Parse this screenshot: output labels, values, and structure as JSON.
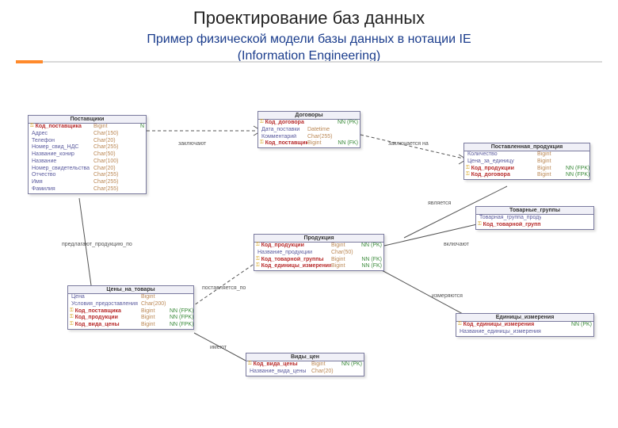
{
  "title": "Проектирование баз данных",
  "subtitle_line1": "Пример физической модели базы данных в нотации IE",
  "subtitle_line2": "(Information Engineering)",
  "entities": {
    "suppliers": {
      "name": "Поставщики",
      "fields": [
        {
          "k": "pk",
          "n": "Код_поставщика",
          "t": "Bigint",
          "f": "N"
        },
        {
          "k": "",
          "n": "Адрес",
          "t": "Char(150)",
          "f": ""
        },
        {
          "k": "",
          "n": "Телефон",
          "t": "Char(20)",
          "f": ""
        },
        {
          "k": "",
          "n": "Номер_свид_НДС",
          "t": "Char(255)",
          "f": ""
        },
        {
          "k": "",
          "n": "Название_конир",
          "t": "Char(50)",
          "f": ""
        },
        {
          "k": "",
          "n": "Название",
          "t": "Char(100)",
          "f": ""
        },
        {
          "k": "",
          "n": "Номер_свидетельства",
          "t": "Char(20)",
          "f": ""
        },
        {
          "k": "",
          "n": "Отчество",
          "t": "Char(255)",
          "f": ""
        },
        {
          "k": "",
          "n": "Имя",
          "t": "Char(255)",
          "f": ""
        },
        {
          "k": "",
          "n": "Фамилия",
          "t": "Char(255)",
          "f": ""
        }
      ]
    },
    "contracts": {
      "name": "Договоры",
      "fields": [
        {
          "k": "pk",
          "n": "Код_договора",
          "t": "",
          "f": "NN (PK)"
        },
        {
          "k": "",
          "n": "Дата_поставки",
          "t": "Datetime",
          "f": ""
        },
        {
          "k": "",
          "n": "Комментарий",
          "t": "Char(255)",
          "f": ""
        },
        {
          "k": "pk",
          "n": "Код_поставщика",
          "t": "Bigint",
          "f": "NN (FK)"
        }
      ]
    },
    "deliveries": {
      "name": "Поставленная_продукция",
      "fields": [
        {
          "k": "",
          "n": "Количество",
          "t": "Bigint",
          "f": ""
        },
        {
          "k": "",
          "n": "Цена_за_единицу",
          "t": "Bigint",
          "f": ""
        },
        {
          "k": "pk",
          "n": "Код_продукции",
          "t": "Bigint",
          "f": "NN (FPK)"
        },
        {
          "k": "pk",
          "n": "Код_договора",
          "t": "Bigint",
          "f": "NN (FPK)"
        }
      ]
    },
    "products": {
      "name": "Продукция",
      "fields": [
        {
          "k": "pk",
          "n": "Код_продукции",
          "t": "Bigint",
          "f": "NN (PK)"
        },
        {
          "k": "",
          "n": "Название_продукции",
          "t": "Char(50)",
          "f": ""
        },
        {
          "k": "pk",
          "n": "Код_товарной_группы",
          "t": "Bigint",
          "f": "NN (FK)"
        },
        {
          "k": "pk",
          "n": "Код_единицы_измерения",
          "t": "Bigint",
          "f": "NN (FK)"
        }
      ]
    },
    "groups": {
      "name": "Товарные_группы",
      "fields": [
        {
          "k": "",
          "n": "Товарная_группа_продукции",
          "t": "",
          "f": ""
        },
        {
          "k": "pk",
          "n": "Код_товарной_группы",
          "t": "",
          "f": ""
        }
      ]
    },
    "units": {
      "name": "Единицы_измерения",
      "fields": [
        {
          "k": "pk",
          "n": "Код_единицы_измерения",
          "t": "",
          "f": "NN (PK)"
        },
        {
          "k": "",
          "n": "Название_единицы_измерения",
          "t": "",
          "f": ""
        }
      ]
    },
    "prices": {
      "name": "Цены_на_товары",
      "fields": [
        {
          "k": "",
          "n": "Цена",
          "t": "Bigint",
          "f": ""
        },
        {
          "k": "",
          "n": "Условия_предоставления",
          "t": "Char(200)",
          "f": ""
        },
        {
          "k": "pk",
          "n": "Код_поставщика",
          "t": "Bigint",
          "f": "NN (FPK)"
        },
        {
          "k": "pk",
          "n": "Код_продукции",
          "t": "Bigint",
          "f": "NN (FPK)"
        },
        {
          "k": "pk",
          "n": "Код_вида_цены",
          "t": "Bigint",
          "f": "NN (FPK)"
        }
      ]
    },
    "pricetypes": {
      "name": "Виды_цен",
      "fields": [
        {
          "k": "pk",
          "n": "Код_вида_цены",
          "t": "Bigint",
          "f": "NN (PK)"
        },
        {
          "k": "",
          "n": "Название_вида_цены",
          "t": "Char(20)",
          "f": ""
        }
      ]
    }
  },
  "relations": {
    "r1": "заключают",
    "r2": "заключается на",
    "r3": "является",
    "r4": "включают",
    "r5": "измеряются",
    "r6": "предлагают_продукцию_по",
    "r7": "поставляется_по",
    "r8": "имеют"
  }
}
